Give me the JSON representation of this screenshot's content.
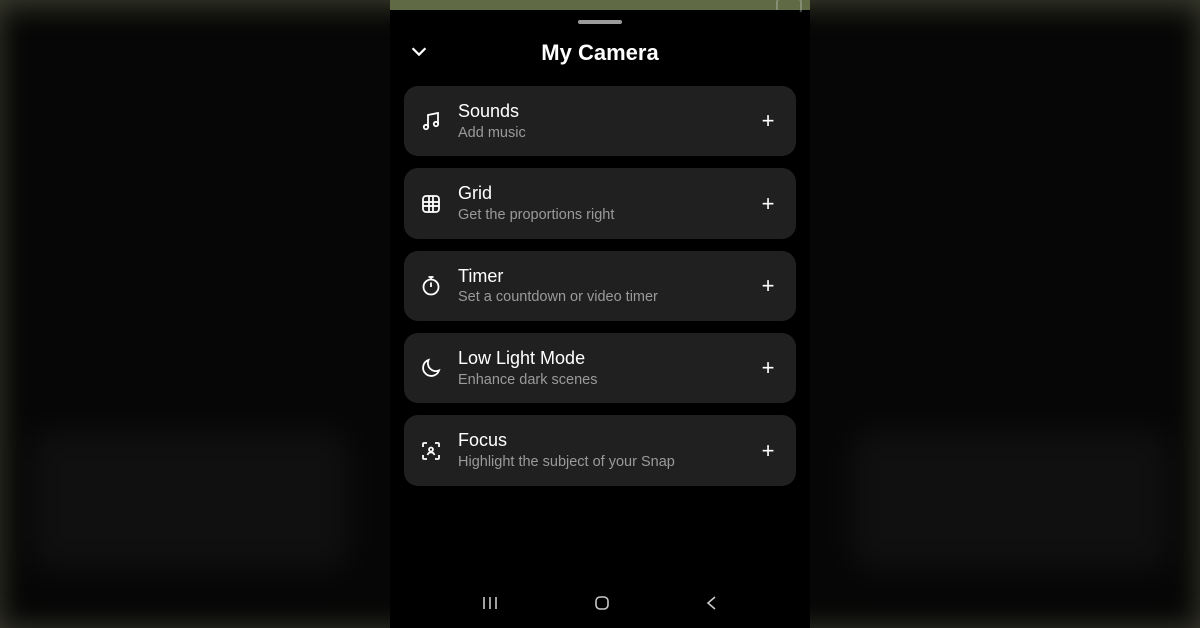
{
  "header": {
    "title": "My Camera"
  },
  "icons": {
    "collapse": "chevron-down-icon",
    "plus": "+",
    "sounds": "music-note-icon",
    "grid": "grid-icon",
    "timer": "stopwatch-icon",
    "low_light": "moon-icon",
    "focus": "focus-icon",
    "nav_recents": "recents-icon",
    "nav_home": "home-icon",
    "nav_back": "back-icon"
  },
  "items": [
    {
      "id": "sounds",
      "title": "Sounds",
      "subtitle": "Add music"
    },
    {
      "id": "grid",
      "title": "Grid",
      "subtitle": "Get the proportions right"
    },
    {
      "id": "timer",
      "title": "Timer",
      "subtitle": "Set a countdown or video timer"
    },
    {
      "id": "low_light",
      "title": "Low Light Mode",
      "subtitle": "Enhance dark scenes"
    },
    {
      "id": "focus",
      "title": "Focus",
      "subtitle": "Highlight the subject of your Snap"
    }
  ]
}
